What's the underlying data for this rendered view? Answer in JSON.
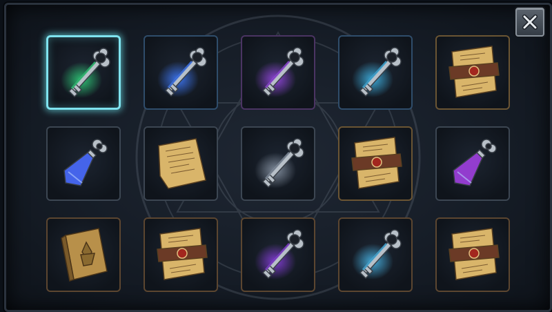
{
  "inventory": {
    "selected_index": 0,
    "slots": [
      {
        "item": "key-icon",
        "frame": "teal",
        "glow": "#2fd07a"
      },
      {
        "item": "key-icon",
        "frame": "blue",
        "glow": "#3f7bff"
      },
      {
        "item": "key-icon",
        "frame": "violet",
        "glow": "#9a48e8"
      },
      {
        "item": "key-icon",
        "frame": "blue",
        "glow": "#3fb6e8"
      },
      {
        "item": "scroll-sealed-icon",
        "frame": "gold",
        "glow": "#c9a25a"
      },
      {
        "item": "potion-icon",
        "frame": "steel",
        "glow": "#4a6cff"
      },
      {
        "item": "parchment-icon",
        "frame": "steel",
        "glow": "#c9a25a"
      },
      {
        "item": "key-icon",
        "frame": "steel",
        "glow": "#8a96a6"
      },
      {
        "item": "scroll-sealed-icon",
        "frame": "gold",
        "glow": "#c9a25a"
      },
      {
        "item": "potion-icon",
        "frame": "steel",
        "glow": "#a040e0"
      },
      {
        "item": "book-icon",
        "frame": "bronze",
        "glow": "#c9a25a"
      },
      {
        "item": "scroll-sealed-icon",
        "frame": "bronze",
        "glow": "#c9a25a"
      },
      {
        "item": "key-icon",
        "frame": "bronze",
        "glow": "#8a3ee0"
      },
      {
        "item": "key-icon",
        "frame": "bronze",
        "glow": "#49b8ea"
      },
      {
        "item": "scroll-sealed-icon",
        "frame": "bronze",
        "glow": "#c9a25a"
      }
    ]
  },
  "colors": {
    "key_metal": "#b8c0c8",
    "parchment": "#d9b56a",
    "seal_red": "#a3261e",
    "ribbon": "#6b3a26"
  }
}
